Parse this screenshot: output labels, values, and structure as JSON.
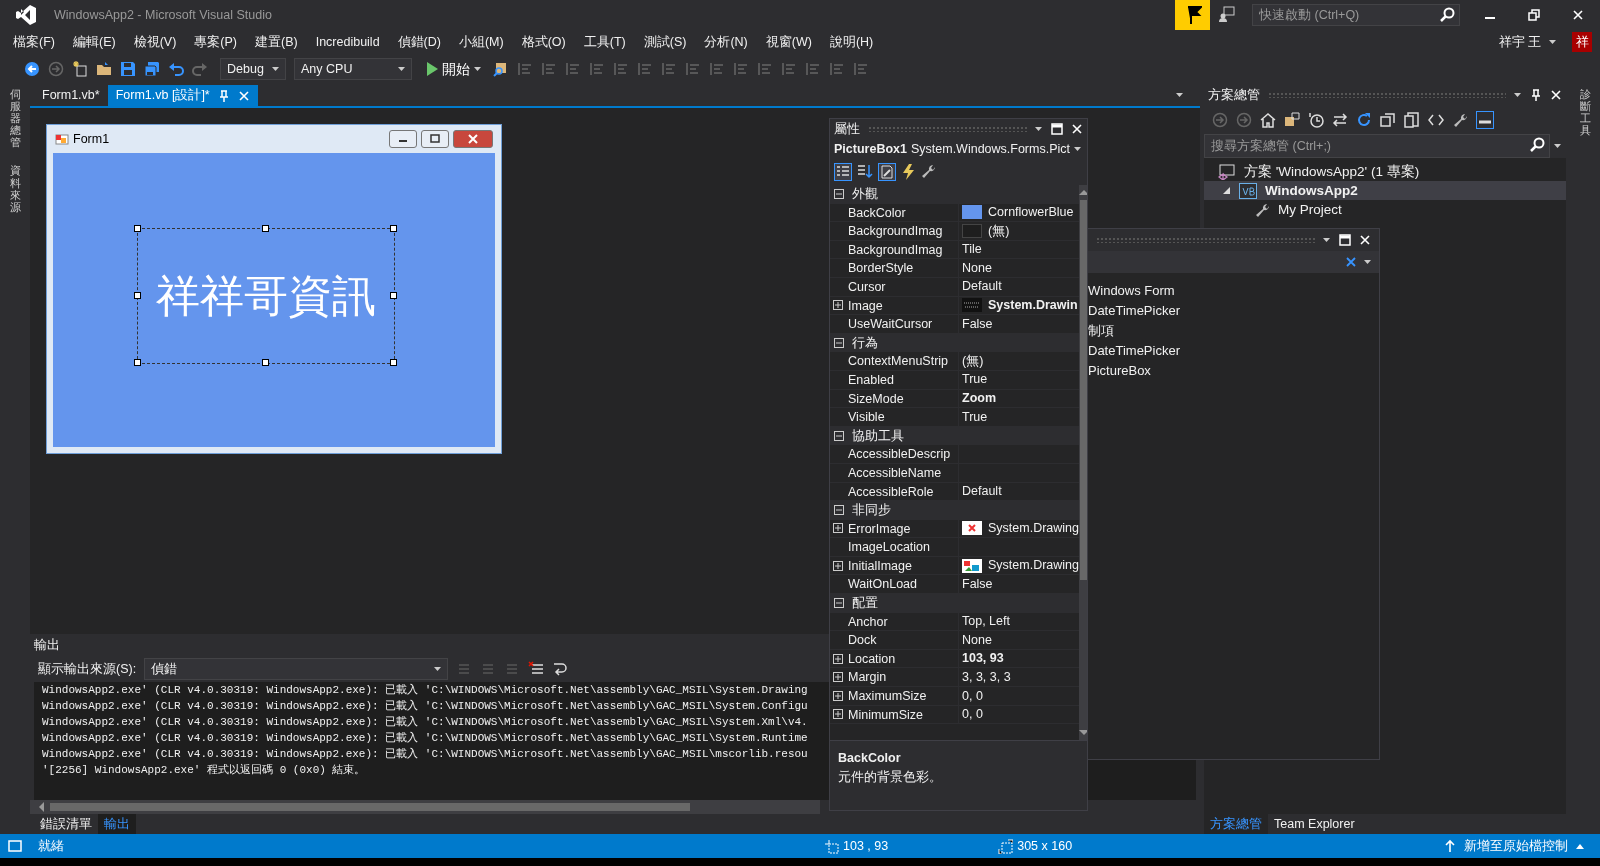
{
  "window": {
    "title": "WindowsApp2 - Microsoft Visual Studio"
  },
  "quick_launch": {
    "placeholder": "快速啟動 (Ctrl+Q)"
  },
  "user": {
    "name": "祥宇 王",
    "avatar": "祥"
  },
  "menu": [
    "檔案(F)",
    "編輯(E)",
    "檢視(V)",
    "專案(P)",
    "建置(B)",
    "Incredibuild",
    "偵錯(D)",
    "小組(M)",
    "格式(O)",
    "工具(T)",
    "測試(S)",
    "分析(N)",
    "視窗(W)",
    "說明(H)"
  ],
  "toolbar": {
    "configuration": "Debug",
    "platform": "Any CPU",
    "start": "開始"
  },
  "left_strip": [
    "伺服器總管",
    "資料來源"
  ],
  "doc_tabs": [
    {
      "label": "Form1.vb*",
      "selected": false
    },
    {
      "label": "Form1.vb [設計]*",
      "selected": true
    }
  ],
  "designer": {
    "form_title": "Form1",
    "picture_text": "祥祥哥資訊"
  },
  "properties": {
    "title": "屬性",
    "object": "PictureBox1",
    "type": "System.Windows.Forms.Pict",
    "categories": [
      {
        "name": "外觀",
        "expanded": true,
        "rows": [
          {
            "name": "BackColor",
            "value": "CornflowerBlue",
            "kind": "color",
            "color": "#6495ed",
            "modified": false
          },
          {
            "name": "BackgroundImag",
            "value": "(無)",
            "kind": "empty",
            "modified": false
          },
          {
            "name": "BackgroundImag",
            "value": "Tile",
            "kind": "text",
            "modified": false
          },
          {
            "name": "BorderStyle",
            "value": "None",
            "kind": "text",
            "modified": false
          },
          {
            "name": "Cursor",
            "value": "Default",
            "kind": "text",
            "modified": false
          },
          {
            "name": "Image",
            "value": "System.Drawin",
            "kind": "image",
            "expandable": true,
            "modified": true
          },
          {
            "name": "UseWaitCursor",
            "value": "False",
            "kind": "text",
            "modified": false
          }
        ]
      },
      {
        "name": "行為",
        "expanded": true,
        "rows": [
          {
            "name": "ContextMenuStrip",
            "value": "(無)",
            "kind": "text",
            "modified": false
          },
          {
            "name": "Enabled",
            "value": "True",
            "kind": "text",
            "modified": false
          },
          {
            "name": "SizeMode",
            "value": "Zoom",
            "kind": "text",
            "modified": true
          },
          {
            "name": "Visible",
            "value": "True",
            "kind": "text",
            "modified": false
          }
        ]
      },
      {
        "name": "協助工具",
        "expanded": true,
        "rows": [
          {
            "name": "AccessibleDescrip",
            "kind": "text"
          },
          {
            "name": "AccessibleName",
            "kind": "text"
          },
          {
            "name": "AccessibleRole",
            "value": "Default",
            "kind": "text",
            "modified": false
          }
        ]
      },
      {
        "name": "非同步",
        "expanded": true,
        "rows": [
          {
            "name": "ErrorImage",
            "value": "System.Drawing",
            "kind": "error",
            "expandable": true,
            "modified": false
          },
          {
            "name": "ImageLocation",
            "kind": "text"
          },
          {
            "name": "InitialImage",
            "value": "System.Drawing",
            "kind": "picture",
            "expandable": true,
            "modified": false
          },
          {
            "name": "WaitOnLoad",
            "value": "False",
            "kind": "text",
            "modified": false
          }
        ]
      },
      {
        "name": "配置",
        "expanded": true,
        "rows": [
          {
            "name": "Anchor",
            "value": "Top, Left",
            "kind": "text",
            "modified": false
          },
          {
            "name": "Dock",
            "value": "None",
            "kind": "text",
            "modified": false
          },
          {
            "name": "Location",
            "value": "103, 93",
            "kind": "text",
            "expandable": true,
            "modified": true
          },
          {
            "name": "Margin",
            "value": "3, 3, 3, 3",
            "kind": "text",
            "expandable": true,
            "modified": false
          },
          {
            "name": "MaximumSize",
            "value": "0, 0",
            "kind": "text",
            "expandable": true,
            "modified": false
          },
          {
            "name": "MinimumSize",
            "value": "0, 0",
            "kind": "text",
            "expandable": true,
            "modified": false
          }
        ]
      }
    ],
    "description_title": "BackColor",
    "description": "元件的背景色彩。"
  },
  "output": {
    "title": "輸出",
    "source_label": "顯示輸出來源(S):",
    "source": "偵錯",
    "lines": [
      "WindowsApp2.exe' (CLR v4.0.30319: WindowsApp2.exe): 已載入 'C:\\WINDOWS\\Microsoft.Net\\assembly\\GAC_MSIL\\System.Drawing",
      "WindowsApp2.exe' (CLR v4.0.30319: WindowsApp2.exe): 已載入 'C:\\WINDOWS\\Microsoft.Net\\assembly\\GAC_MSIL\\System.Configu",
      "WindowsApp2.exe' (CLR v4.0.30319: WindowsApp2.exe): 已載入 'C:\\WINDOWS\\Microsoft.Net\\assembly\\GAC_MSIL\\System.Xml\\v4.",
      "WindowsApp2.exe' (CLR v4.0.30319: WindowsApp2.exe): 已載入 'C:\\WINDOWS\\Microsoft.Net\\assembly\\GAC_MSIL\\System.Runtime",
      "WindowsApp2.exe' (CLR v4.0.30319: WindowsApp2.exe): 已載入 'C:\\WINDOWS\\Microsoft.Net\\assembly\\GAC_MSIL\\mscorlib.resou",
      "'[2256] WindowsApp2.exe' 程式以返回碼 0 (0x0) 結束。"
    ]
  },
  "bottom_tabs": [
    {
      "label": "錯誤清單",
      "selected": false
    },
    {
      "label": "輸出",
      "selected": true
    }
  ],
  "solution_explorer": {
    "title": "方案總管",
    "search_placeholder": "搜尋方案總管 (Ctrl+;)",
    "tree": [
      {
        "label": "方案 'WindowsApp2' (1 專案)",
        "kind": "solution",
        "selected": false,
        "children": [
          {
            "label": "WindowsApp2",
            "kind": "project",
            "selected": true,
            "expanded": true,
            "children": [
              {
                "label": "My Project",
                "kind": "settings",
                "selected": false
              }
            ]
          }
        ]
      }
    ]
  },
  "solution_tabs": [
    {
      "label": "方案總管",
      "selected": true
    },
    {
      "label": "Team Explorer",
      "selected": false
    }
  ],
  "toolbox": {
    "items": [
      "Windows Form",
      "DateTimePicker",
      "制項",
      "DateTimePicker",
      "PictureBox"
    ]
  },
  "right_strip": [
    "診斷工具"
  ],
  "status_bar": {
    "message": "就緒",
    "position": "103 , 93",
    "size": "305 x 160",
    "source_control": "新增至原始檔控制"
  }
}
